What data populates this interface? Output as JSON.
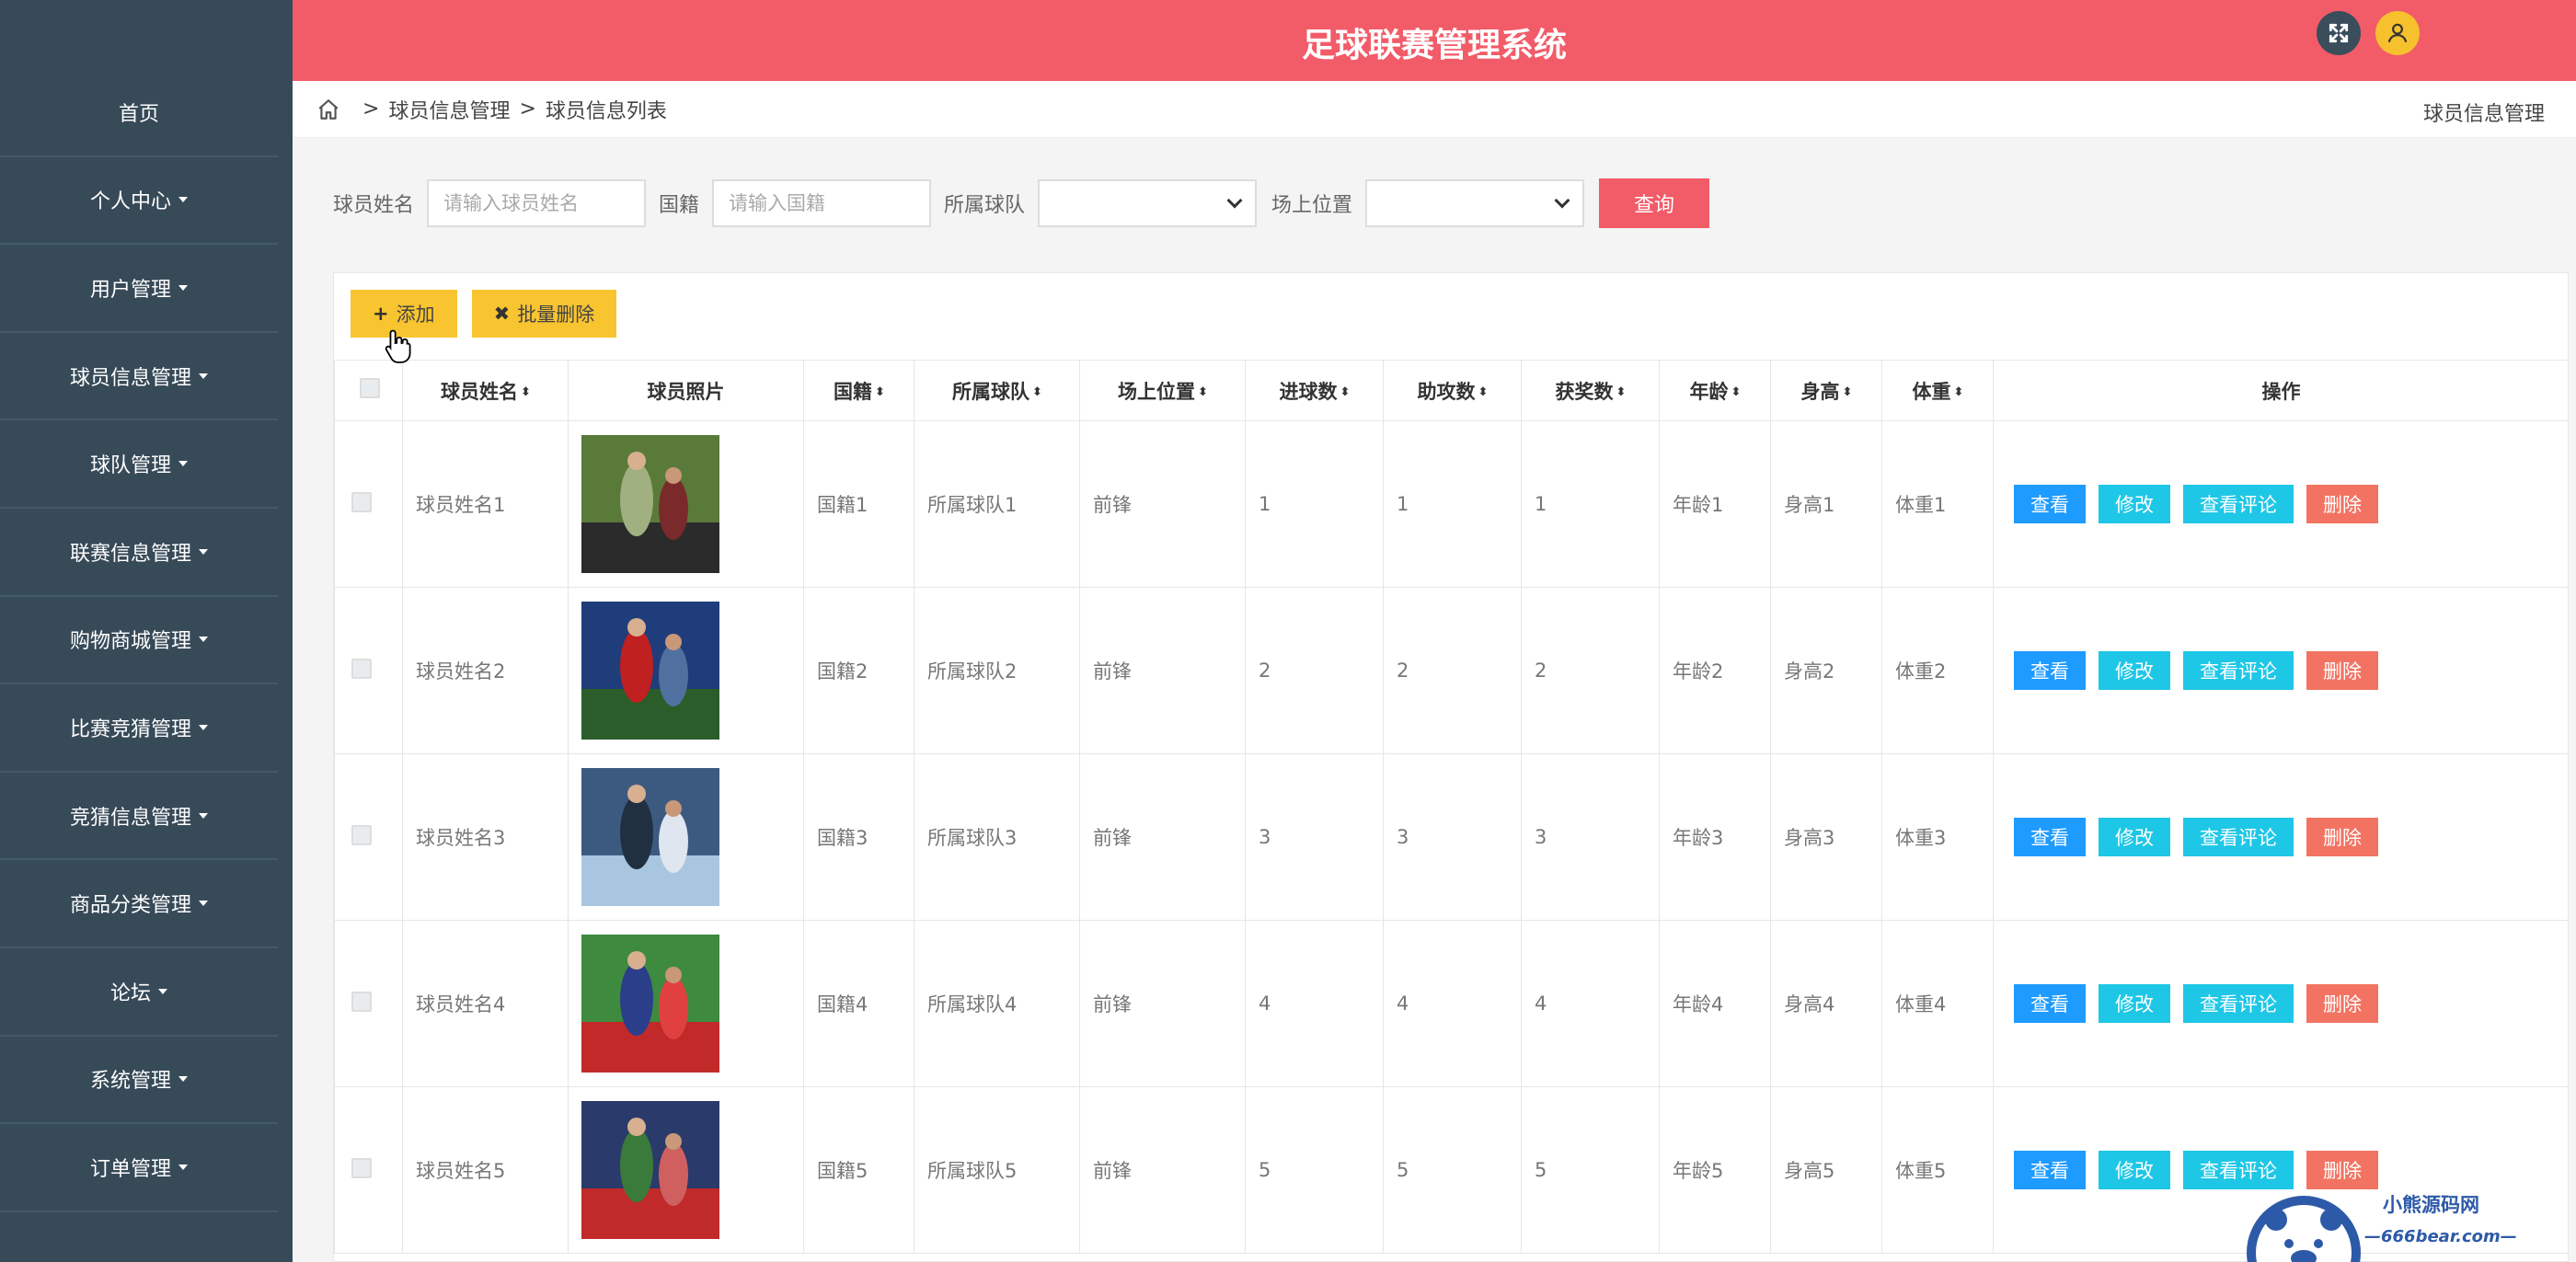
{
  "app": {
    "title": "足球联赛管理系统"
  },
  "sidebar": {
    "items": [
      {
        "label": "首页",
        "has_caret": false
      },
      {
        "label": "个人中心",
        "has_caret": true
      },
      {
        "label": "用户管理",
        "has_caret": true
      },
      {
        "label": "球员信息管理",
        "has_caret": true
      },
      {
        "label": "球队管理",
        "has_caret": true
      },
      {
        "label": "联赛信息管理",
        "has_caret": true
      },
      {
        "label": "购物商城管理",
        "has_caret": true
      },
      {
        "label": "比赛竞猜管理",
        "has_caret": true
      },
      {
        "label": "竞猜信息管理",
        "has_caret": true
      },
      {
        "label": "商品分类管理",
        "has_caret": true
      },
      {
        "label": "论坛",
        "has_caret": true
      },
      {
        "label": "系统管理",
        "has_caret": true
      },
      {
        "label": "订单管理",
        "has_caret": true
      }
    ]
  },
  "breadcrumb": {
    "level1": "球员信息管理",
    "level2": "球员信息列表",
    "sep": ">",
    "right_label": "球员信息管理"
  },
  "search": {
    "name_label": "球员姓名",
    "name_placeholder": "请输入球员姓名",
    "nationality_label": "国籍",
    "nationality_placeholder": "请输入国籍",
    "team_label": "所属球队",
    "team_value": "",
    "position_label": "场上位置",
    "position_value": "",
    "submit_label": "查询"
  },
  "toolbar": {
    "add_label": "添加",
    "add_glyph": "+",
    "batch_delete_label": "批量删除",
    "batch_delete_glyph": "✖"
  },
  "table": {
    "headers": [
      "球员姓名",
      "球员照片",
      "国籍",
      "所属球队",
      "场上位置",
      "进球数",
      "助攻数",
      "获奖数",
      "年龄",
      "身高",
      "体重",
      "操作"
    ],
    "sort_glyph": "⬍",
    "rows": [
      {
        "name": "球员姓名1",
        "nationality": "国籍1",
        "team": "所属球队1",
        "position": "前锋",
        "goals": "1",
        "assists": "1",
        "awards": "1",
        "age": "年龄1",
        "height": "身高1",
        "weight": "体重1"
      },
      {
        "name": "球员姓名2",
        "nationality": "国籍2",
        "team": "所属球队2",
        "position": "前锋",
        "goals": "2",
        "assists": "2",
        "awards": "2",
        "age": "年龄2",
        "height": "身高2",
        "weight": "体重2"
      },
      {
        "name": "球员姓名3",
        "nationality": "国籍3",
        "team": "所属球队3",
        "position": "前锋",
        "goals": "3",
        "assists": "3",
        "awards": "3",
        "age": "年龄3",
        "height": "身高3",
        "weight": "体重3"
      },
      {
        "name": "球员姓名4",
        "nationality": "国籍4",
        "team": "所属球队4",
        "position": "前锋",
        "goals": "4",
        "assists": "4",
        "awards": "4",
        "age": "年龄4",
        "height": "身高4",
        "weight": "体重4"
      },
      {
        "name": "球员姓名5",
        "nationality": "国籍5",
        "team": "所属球队5",
        "position": "前锋",
        "goals": "5",
        "assists": "5",
        "awards": "5",
        "age": "年龄5",
        "height": "身高5",
        "weight": "体重5"
      }
    ],
    "actions": {
      "view": "查看",
      "edit": "修改",
      "comments": "查看评论",
      "delete": "删除"
    }
  },
  "watermark": {
    "brand": "小熊源码网",
    "domain": "—666bear.com—"
  },
  "colors": {
    "sidebar_bg": "#374a58",
    "header_bg": "#f25b68",
    "accent_yellow": "#f8c42f",
    "view_blue": "#1e9bff",
    "edit_cyan": "#1ec7e6",
    "delete_red": "#f37362"
  }
}
